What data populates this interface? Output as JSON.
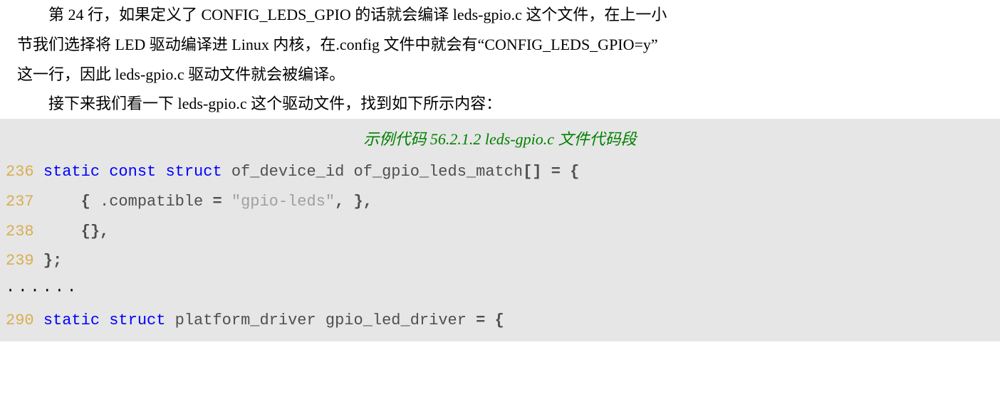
{
  "prose": {
    "p1": "第 24 行，如果定义了 CONFIG_LEDS_GPIO 的话就会编译 leds-gpio.c 这个文件，在上一小",
    "p1b": "节我们选择将 LED 驱动编译进 Linux 内核，在.config 文件中就会有“CONFIG_LEDS_GPIO=y”",
    "p1c": "这一行，因此 leds-gpio.c 驱动文件就会被编译。",
    "p2": "接下来我们看一下 leds-gpio.c 这个驱动文件，找到如下所示内容："
  },
  "code": {
    "title": "示例代码 56.2.1.2 leds-gpio.c 文件代码段",
    "lines": [
      {
        "ln": "236",
        "kw": "static const struct",
        "id": " of_device_id of_gpio_leds_match",
        "br": "[] = {"
      },
      {
        "ln": "237",
        "indent": "     ",
        "brl": "{ ",
        "member": ".compatible ",
        "eq": "= ",
        "str": "\"gpio-leds\"",
        "brr": ", },"
      },
      {
        "ln": "238",
        "indent": "     ",
        "text": "{},"
      },
      {
        "ln": "239",
        "text": " };"
      },
      {
        "dots": "······"
      },
      {
        "ln": "290",
        "kw": "static struct",
        "id": " platform_driver gpio_led_driver ",
        "br": "= {"
      }
    ]
  }
}
